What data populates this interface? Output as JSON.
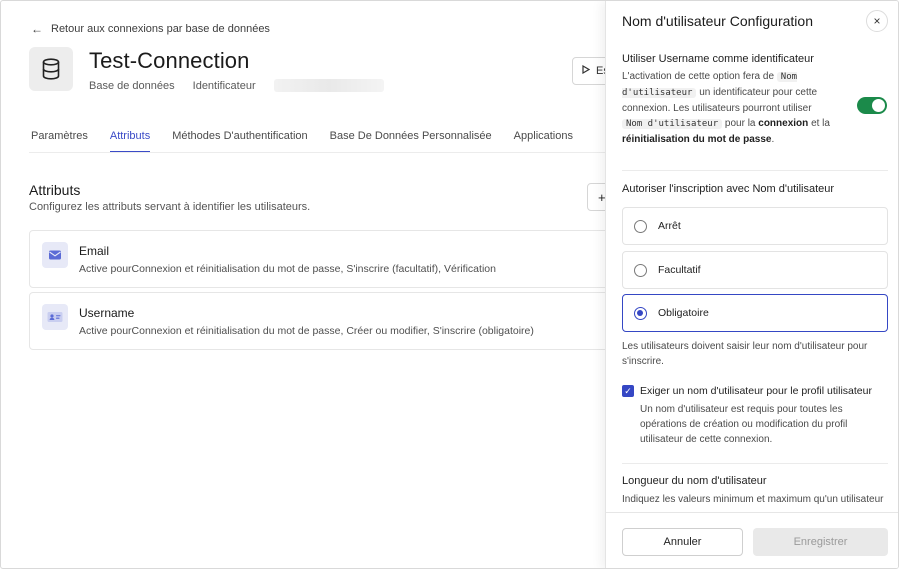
{
  "header": {
    "back_label": "Retour aux connexions par base de données",
    "title": "Test-Connection",
    "type_label": "Base de données",
    "identifier_label": "Identificateur",
    "try_label": "Es"
  },
  "tabs": [
    {
      "label": "Paramètres"
    },
    {
      "label": "Attributs"
    },
    {
      "label": "Méthodes D'authentification"
    },
    {
      "label": "Base De Données Personnalisée"
    },
    {
      "label": "Applications"
    }
  ],
  "attributes": {
    "title": "Attributs",
    "subtitle": "Configurez les attributs servant à identifier les utilisateurs.",
    "add_label": "+",
    "items": [
      {
        "name": "Email",
        "description": "Active pourConnexion et réinitialisation du mot de passe, S'inscrire (facultatif), Vérification"
      },
      {
        "name": "Username",
        "description": "Active pourConnexion et réinitialisation du mot de passe, Créer ou modifier, S'inscrire (obligatoire)"
      }
    ]
  },
  "panel": {
    "title": "Nom d'utilisateur Configuration",
    "close_icon": "×",
    "identifier": {
      "label": "Utiliser Username comme identificateur",
      "text_1": "L'activation de cette option fera de",
      "code_1": "Nom d'utilisateur",
      "text_2": "un identificateur pour cette connexion. Les utilisateurs pourront utiliser",
      "code_2": "Nom d'utilisateur",
      "text_3": "pour la",
      "bold_1": "connexion",
      "text_4": "et la",
      "bold_2": "réinitialisation du mot de passe",
      "text_5": ".",
      "enabled": true,
      "toggle_color": "#1b8a4a"
    },
    "signup": {
      "label": "Autoriser l'inscription avec Nom d'utilisateur",
      "options": [
        {
          "label": "Arrêt"
        },
        {
          "label": "Facultatif"
        },
        {
          "label": "Obligatoire"
        }
      ],
      "selected": "Obligatoire",
      "help": "Les utilisateurs doivent saisir leur nom d'utilisateur pour s'inscrire."
    },
    "require_profile": {
      "label": "Exiger un nom d'utilisateur pour le profil utilisateur",
      "description": "Un nom d'utilisateur est requis pour toutes les opérations de création ou modification du profil utilisateur de cette connexion.",
      "checked": true
    },
    "length": {
      "label": "Longueur du nom d'utilisateur",
      "description": "Indiquez les valeurs minimum et maximum qu'un utilisateur"
    },
    "footer": {
      "cancel_label": "Annuler",
      "save_label": "Enregistrer"
    },
    "accent_color": "#3547c4"
  }
}
